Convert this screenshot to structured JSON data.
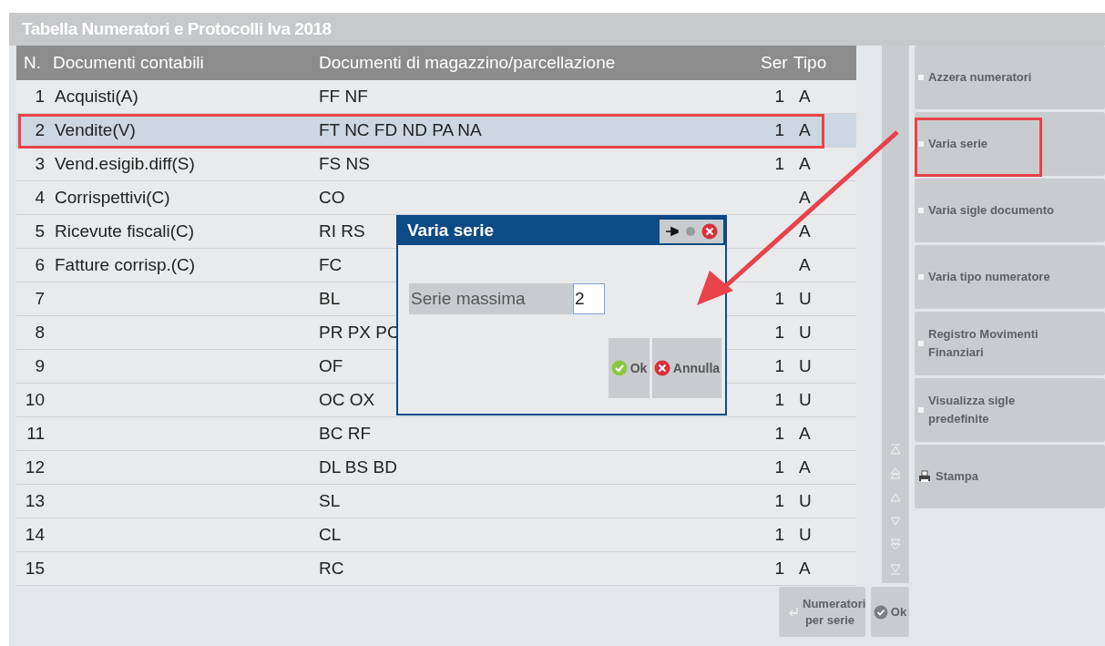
{
  "window": {
    "title": "Tabella Numeratori e Protocolli Iva 2018"
  },
  "table": {
    "columns": [
      "N.",
      "Documenti contabili",
      "Documenti di magazzino/parcellazione",
      "Ser",
      "Tipo"
    ],
    "rows": [
      {
        "n": "1",
        "contabili": "Acquisti(A)",
        "magazzino": "FF NF",
        "ser": "1",
        "tipo": "A",
        "selected": false
      },
      {
        "n": "2",
        "contabili": "Vendite(V)",
        "magazzino": "FT NC FD ND PA NA",
        "ser": "1",
        "tipo": "A",
        "selected": true
      },
      {
        "n": "3",
        "contabili": "Vend.esigib.diff(S)",
        "magazzino": "FS NS",
        "ser": "1",
        "tipo": "A",
        "selected": false
      },
      {
        "n": "4",
        "contabili": "Corrispettivi(C)",
        "magazzino": "CO",
        "ser": "",
        "tipo": "A",
        "selected": false
      },
      {
        "n": "5",
        "contabili": "Ricevute fiscali(C)",
        "magazzino": "RI RS",
        "ser": "",
        "tipo": "A",
        "selected": false
      },
      {
        "n": "6",
        "contabili": "Fatture corrisp.(C)",
        "magazzino": "FC",
        "ser": "",
        "tipo": "A",
        "selected": false
      },
      {
        "n": "7",
        "contabili": "",
        "magazzino": "BL",
        "ser": "1",
        "tipo": "U",
        "selected": false
      },
      {
        "n": "8",
        "contabili": "",
        "magazzino": "PR PX PC",
        "ser": "1",
        "tipo": "U",
        "selected": false
      },
      {
        "n": "9",
        "contabili": "",
        "magazzino": "OF",
        "ser": "1",
        "tipo": "U",
        "selected": false
      },
      {
        "n": "10",
        "contabili": "",
        "magazzino": "OC OX",
        "ser": "1",
        "tipo": "U",
        "selected": false
      },
      {
        "n": "11",
        "contabili": "",
        "magazzino": "BC RF",
        "ser": "1",
        "tipo": "A",
        "selected": false
      },
      {
        "n": "12",
        "contabili": "",
        "magazzino": "DL BS BD",
        "ser": "1",
        "tipo": "A",
        "selected": false
      },
      {
        "n": "13",
        "contabili": "",
        "magazzino": "SL",
        "ser": "1",
        "tipo": "U",
        "selected": false
      },
      {
        "n": "14",
        "contabili": "",
        "magazzino": "CL",
        "ser": "1",
        "tipo": "U",
        "selected": false
      },
      {
        "n": "15",
        "contabili": "",
        "magazzino": "RC",
        "ser": "1",
        "tipo": "A",
        "selected": false
      }
    ]
  },
  "side_buttons": [
    {
      "label": "Azzera numeratori",
      "kind": "bullet"
    },
    {
      "label": "Varia serie",
      "kind": "bullet"
    },
    {
      "label": "Varia sigle documento",
      "kind": "bullet"
    },
    {
      "label": "Varia tipo numeratore",
      "kind": "bullet"
    },
    {
      "label": "Registro Movimenti Finanziari",
      "kind": "bullet"
    },
    {
      "label": "Visualizza sigle predefinite",
      "kind": "bullet"
    },
    {
      "label": "Stampa",
      "kind": "print"
    }
  ],
  "bottom_buttons": [
    {
      "label": "Numeratori per serie",
      "kind": "return"
    },
    {
      "label": "Ok",
      "kind": "ok"
    }
  ],
  "dialog": {
    "title": "Varia serie",
    "field_label": "Serie massima",
    "field_value": "2",
    "buttons": [
      {
        "label": "Ok",
        "kind": "ok"
      },
      {
        "label": "Annulla",
        "kind": "cancel"
      }
    ]
  }
}
